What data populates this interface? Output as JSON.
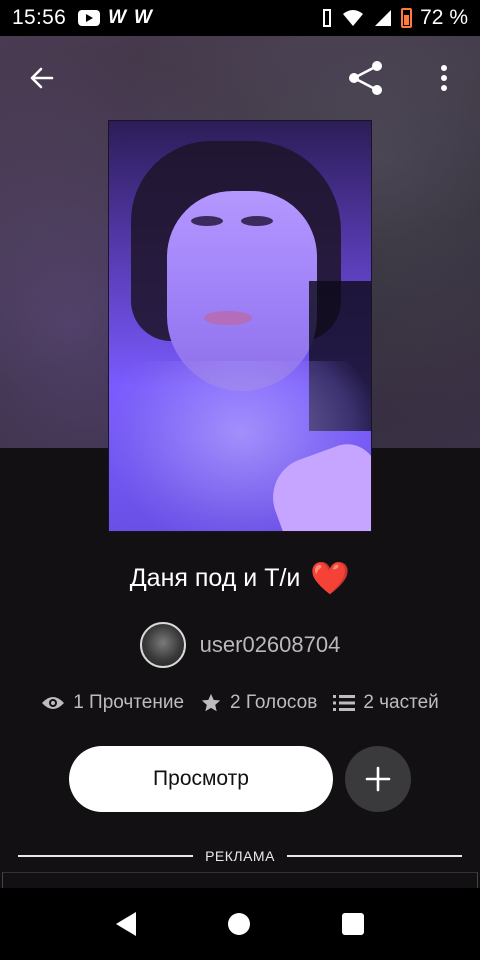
{
  "status_bar": {
    "time": "15:56",
    "notification_icons": [
      "youtube-icon",
      "wattpad-icon",
      "wattpad-icon"
    ],
    "status_icons": [
      "vibrate-icon",
      "wifi-icon",
      "signal-icon",
      "battery-icon"
    ],
    "battery_percent": "72 %",
    "battery_level": 0.72
  },
  "toolbar": {
    "back_icon": "arrow-left-icon",
    "share_icon": "share-icon",
    "more_icon": "more-vertical-icon"
  },
  "story": {
    "title": "Даня под и Т/и",
    "title_emoji": "❤️",
    "author": "user02608704",
    "stats": {
      "reads": "1 Прочтение",
      "votes": "2 Голосов",
      "parts": "2 частей"
    },
    "read_button_label": "Просмотр",
    "add_icon": "plus-icon"
  },
  "ad": {
    "label": "РЕКЛАМА"
  },
  "nav": {
    "icons": [
      "back-triangle-icon",
      "home-circle-icon",
      "recents-square-icon"
    ]
  },
  "colors": {
    "background": "#121012",
    "button_primary": "#ffffff",
    "button_secondary": "#3a393c",
    "heart": "#e8423a",
    "battery": "#ff7a3c"
  }
}
